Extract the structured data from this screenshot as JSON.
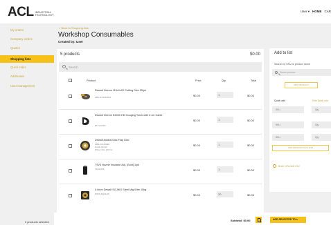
{
  "header": {
    "logo_mark": "ACL",
    "logo_sub_1": "INDUSTRIAL",
    "logo_sub_2": "TECHNOLOGY",
    "nav_user": "User",
    "nav_caret": "▾",
    "nav_home": "HOME",
    "nav_cart": "CAR"
  },
  "sidebar": {
    "items": [
      {
        "label": "My orders"
      },
      {
        "label": "Company orders"
      },
      {
        "label": "Quotes"
      },
      {
        "label": "Shopping lists"
      },
      {
        "label": "Quick order"
      },
      {
        "label": "Addresses"
      },
      {
        "label": "User management"
      }
    ]
  },
  "main": {
    "back_link": "< Back to Shopping lists",
    "title": "Workshop Consumables",
    "created_by": "Created by: User",
    "products_count": "5 products",
    "products_total": "$0.00",
    "search_placeholder": "Search",
    "columns": {
      "product": "Product",
      "price": "Price",
      "qty": "Qty",
      "total": "Total"
    }
  },
  "rows": [
    {
      "name": "Dewalt Xtreme 115x1x22 Cutting Disc 25/pk",
      "sub": [
        "ABC-DX1234522"
      ],
      "price": "$0.00",
      "qty": "1",
      "total": "$0.00"
    },
    {
      "name": "Dewalt Xtreme E4000 HD Gouging Torch with 2.1m Cable",
      "sub": [
        "ETT-DH401"
      ],
      "price": "$0.00",
      "qty": "1",
      "total": "$0.00"
    },
    {
      "name": "Dewalt Austral Disc Flap Disc",
      "sub": [
        "ABR-ZA125060",
        "Grade 60 Grit",
        "Wheel Size 125mm"
      ],
      "price": "$0.00",
      "qty": "1",
      "total": "$0.00"
    },
    {
      "name": "T9V3 Nozzle Insulator Adj. [Gold] 1/pk",
      "sub": [
        "TAZ11456"
      ],
      "price": "$0.00",
      "qty": "1",
      "total": "$0.00"
    },
    {
      "name": "0.9mm Dewalt SG-MIG Steel Mig Wire 15kg",
      "sub": [
        "DWW-SG09-15"
      ],
      "price": "$0.00",
      "qty": "20",
      "total": "$0.00"
    }
  ],
  "footer": {
    "selected": "0 products selected",
    "subtotal": "Subtotal: $0.00",
    "add_selected": "ADD SELECTED TO  ▾"
  },
  "add_panel": {
    "title": "Add to list",
    "search_label": "Search by SKU or product name",
    "search_placeholder": "Search product",
    "add_product_btn": "ADD PRODUCT",
    "quick_add_label": "Quick add",
    "quick_add_link": "Hide Quick add",
    "sku_placeholder": "SKU",
    "qty_placeholder": "Qty",
    "add_products_btn": "ADD PRODUCTS TO LIST",
    "bulk_label": "BULK UPLOAD CSV"
  },
  "colors": {
    "accent": "#f6c21a",
    "link": "#c8a23a",
    "field_bg": "#ececec"
  }
}
